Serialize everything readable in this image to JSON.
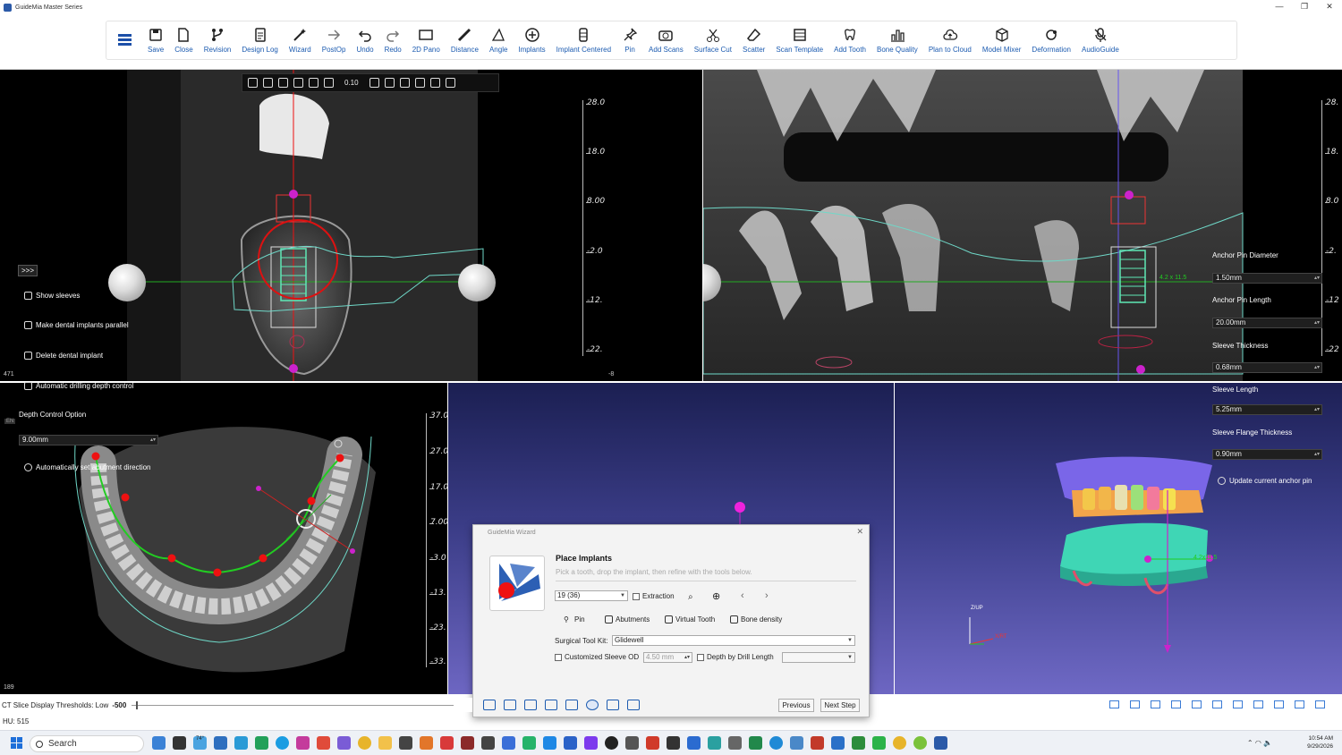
{
  "window": {
    "title": "GuideMia Master Series",
    "controls": [
      "—",
      "❐",
      "✕"
    ]
  },
  "toolbar": {
    "items": [
      {
        "label": "Save",
        "icon": "save-icon"
      },
      {
        "label": "Close",
        "icon": "close-file-icon"
      },
      {
        "label": "Revision",
        "icon": "revision-icon"
      },
      {
        "label": "Design Log",
        "icon": "design-log-icon"
      },
      {
        "label": "Wizard",
        "icon": "wizard-icon"
      },
      {
        "label": "PostOp",
        "icon": "postop-icon"
      },
      {
        "label": "Undo",
        "icon": "undo-icon"
      },
      {
        "label": "Redo",
        "icon": "redo-icon"
      },
      {
        "label": "2D Pano",
        "icon": "pano-icon"
      },
      {
        "label": "Distance",
        "icon": "distance-icon"
      },
      {
        "label": "Angle",
        "icon": "angle-icon"
      },
      {
        "label": "Implants",
        "icon": "implants-icon"
      },
      {
        "label": "Implant Centered",
        "icon": "implant-centered-icon"
      },
      {
        "label": "Pin",
        "icon": "pin-icon"
      },
      {
        "label": "Add Scans",
        "icon": "add-scans-icon"
      },
      {
        "label": "Surface Cut",
        "icon": "scissors-icon"
      },
      {
        "label": "Scatter",
        "icon": "eraser-icon"
      },
      {
        "label": "Scan Template",
        "icon": "scan-template-icon"
      },
      {
        "label": "Add Tooth",
        "icon": "tooth-icon"
      },
      {
        "label": "Bone Quality",
        "icon": "bar-chart-icon"
      },
      {
        "label": "Plan to Cloud",
        "icon": "cloud-icon"
      },
      {
        "label": "Model Mixer",
        "icon": "cube-icon"
      },
      {
        "label": "Deformation",
        "icon": "deformation-icon"
      },
      {
        "label": "AudioGuide",
        "icon": "mic-icon"
      }
    ]
  },
  "viewer_toolbar": {
    "zoom": "0.10"
  },
  "left_panel": {
    "expand": ">>>",
    "show_sleeves": "Show sleeves",
    "make_parallel": "Make dental implants parallel",
    "delete_implant": "Delete dental implant",
    "auto_depth": "Automatic drilling depth control",
    "depth_option_label": "Depth Control Option",
    "depth_value": "9.00mm",
    "auto_abutment": "Automatically set abutment direction",
    "slice_num_top": "471",
    "slice_num_bottom": "189",
    "en_badge": "EN"
  },
  "rulers": {
    "cross": [
      "28.0",
      "18.0",
      "8.00",
      "-2.0",
      "-12.",
      "-22."
    ],
    "pano": [
      "28.",
      "18.",
      "8.0",
      "-2.",
      "-12",
      "-22"
    ],
    "axial": [
      "37.0",
      "27.0",
      "17.0",
      "7.00",
      "-3.0",
      "-13.",
      "-23.",
      "-33."
    ],
    "pano_side_num": "-8"
  },
  "right_panel": {
    "anchor_pin_diameter_label": "Anchor Pin Diameter",
    "anchor_pin_diameter": "1.50mm",
    "anchor_pin_length_label": "Anchor Pin Length",
    "anchor_pin_length": "20.00mm",
    "sleeve_thickness_label": "Sleeve Thickness",
    "sleeve_thickness": "0.68mm",
    "sleeve_length_label": "Sleeve Length",
    "sleeve_length": "5.25mm",
    "sleeve_flange_label": "Sleeve Flange Thickness",
    "sleeve_flange": "0.90mm",
    "update_pin": "Update current anchor pin",
    "pano_label": "4.2 x 11.5",
    "model_label": "4.2x11.5",
    "axis_up": "Z/UP",
    "axis_rt": "X/RT"
  },
  "wizard": {
    "title": "GuideMia Wizard",
    "heading": "Place Implants",
    "subtitle": "Pick a tooth, drop the implant, then refine with the tools below.",
    "tooth_select": "19  (36)",
    "extraction": "Extraction",
    "pin": "Pin",
    "abutments": "Abutments",
    "virtual_tooth": "Virtual Tooth",
    "bone_density": "Bone density",
    "surgical_kit_label": "Surgical Tool Kit:",
    "surgical_kit": "Glidewell",
    "customized_sleeve": "Customized Sleeve OD",
    "sleeve_od": "4.50 mm",
    "depth_by_drill": "Depth by Drill Length",
    "previous": "Previous",
    "next": "Next Step"
  },
  "status": {
    "threshold_label": "CT Slice Display Thresholds: Low",
    "threshold_value": "-500",
    "hu": "HU: 515"
  },
  "taskbar": {
    "search": "Search",
    "weather": "74°",
    "time": "10:54 AM",
    "date": "9/29/2026"
  },
  "colors": {
    "accent": "#1c5bb0",
    "implant_green": "#5fe8b5",
    "arch_green": "#22cc22",
    "marker_red": "#ee1111",
    "pin_magenta": "#cc22cc"
  }
}
